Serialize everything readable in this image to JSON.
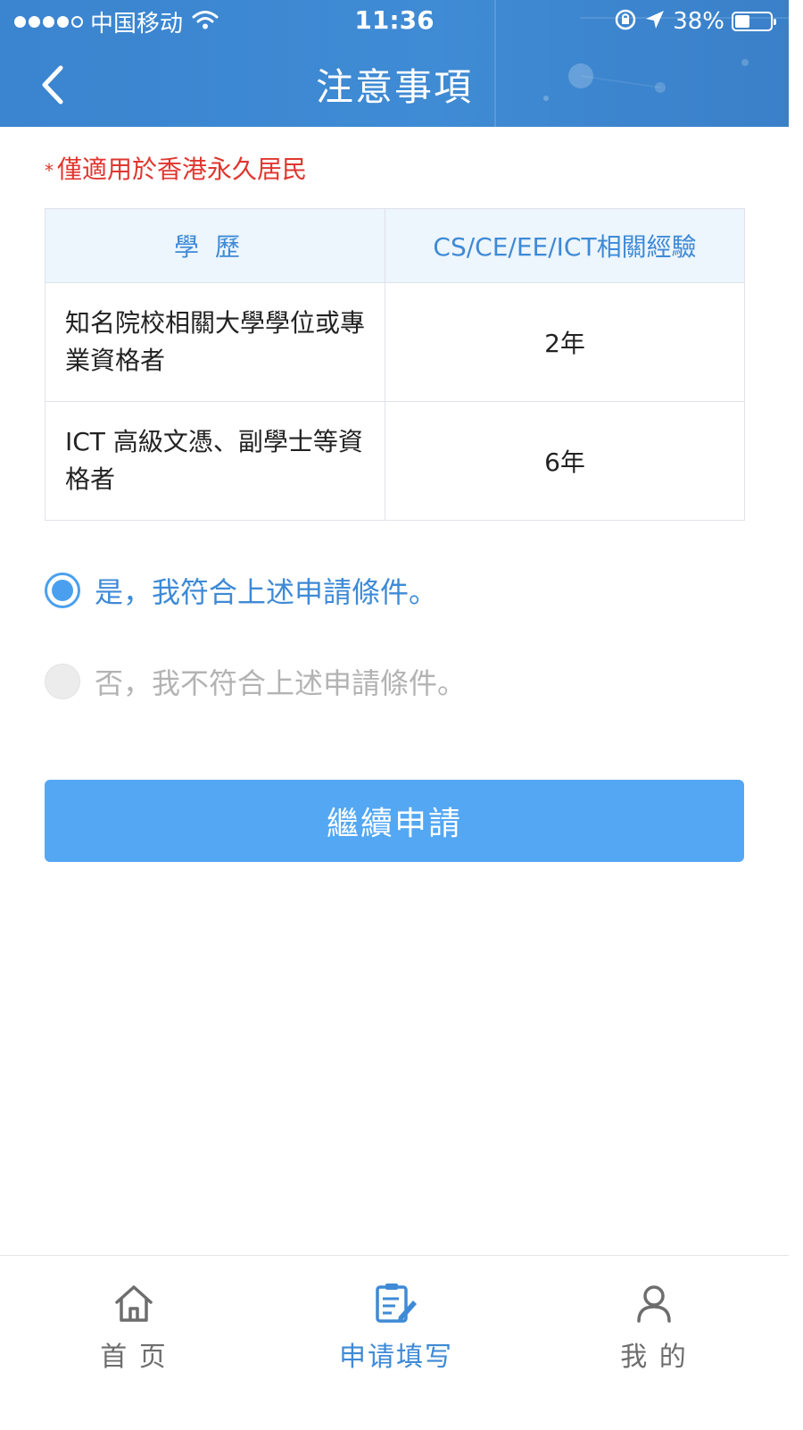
{
  "status_bar": {
    "carrier": "中国移动",
    "time": "11:36",
    "battery": "38%",
    "battery_level": 0.38
  },
  "header": {
    "title": "注意事項",
    "back_icon": "chevron-left-icon"
  },
  "notice": {
    "star": "*",
    "text": "僅適用於香港永久居民",
    "color": "#e0362f"
  },
  "table": {
    "headers": [
      "學歷",
      "CS/CE/EE/ICT相關經驗"
    ],
    "rows": [
      [
        "知名院校相關大學學位或專業資格者",
        "2年"
      ],
      [
        "ICT 高級文憑、副學士等資格者",
        "6年"
      ]
    ]
  },
  "options": [
    {
      "label": "是，我符合上述申請條件。",
      "selected": true
    },
    {
      "label": "否，我不符合上述申請條件。",
      "selected": false
    }
  ],
  "continue_button": {
    "label": "繼續申請"
  },
  "tabbar": {
    "items": [
      {
        "label": "首 页",
        "icon": "home-icon",
        "active": false
      },
      {
        "label": "申请填写",
        "icon": "edit-form-icon",
        "active": true
      },
      {
        "label": "我 的",
        "icon": "user-icon",
        "active": false
      }
    ]
  },
  "colors": {
    "accent": "#3e8ad6",
    "header_bg": "#3b84cf",
    "button_bg": "#53a7f3",
    "notice_red": "#e0362f"
  }
}
